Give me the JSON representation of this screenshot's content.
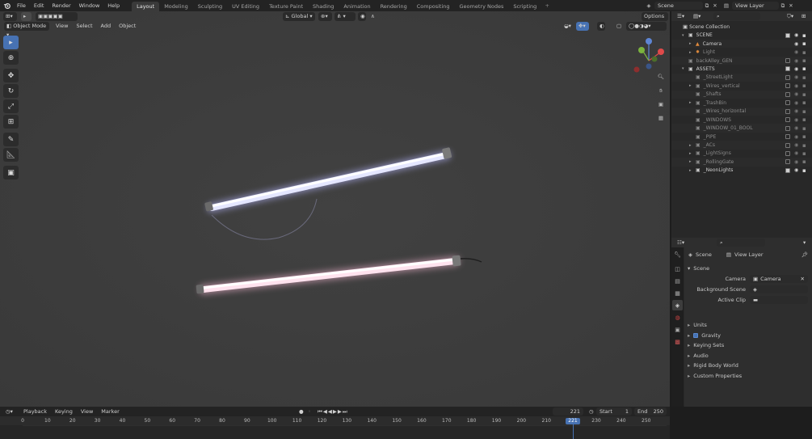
{
  "topbar": {
    "menus": [
      "File",
      "Edit",
      "Render",
      "Window",
      "Help"
    ],
    "workspaces": [
      "Layout",
      "Modeling",
      "Sculpting",
      "UV Editing",
      "Texture Paint",
      "Shading",
      "Animation",
      "Rendering",
      "Compositing",
      "Geometry Nodes",
      "Scripting"
    ],
    "active_workspace": "Layout",
    "scene_name": "Scene",
    "view_layer": "View Layer"
  },
  "viewport_header": {
    "mode": "Object Mode",
    "menus": [
      "View",
      "Select",
      "Add",
      "Object"
    ],
    "transform_orientation": "Global",
    "options_label": "Options"
  },
  "toolbar": {
    "tools": [
      "select-box-tool",
      "cursor-tool",
      "move-tool",
      "rotate-tool",
      "scale-tool",
      "transform-tool",
      "annotate-tool",
      "measure-tool",
      "add-cube-tool"
    ]
  },
  "outliner": {
    "title": "Scene Collection",
    "rows": [
      {
        "label": "SCENE",
        "indent": 1,
        "expand": "open",
        "checked": true,
        "dim": false
      },
      {
        "label": "Camera",
        "indent": 2,
        "expand": "closed",
        "checked": null,
        "dim": false
      },
      {
        "label": "Light",
        "indent": 2,
        "expand": "closed",
        "checked": null,
        "dim": true
      },
      {
        "label": "backAlley_GEN",
        "indent": 1,
        "expand": "none",
        "checked": false,
        "dim": true
      },
      {
        "label": "ASSETS",
        "indent": 1,
        "expand": "open",
        "checked": true,
        "dim": false
      },
      {
        "label": "_StreetLight",
        "indent": 2,
        "expand": "none",
        "checked": false,
        "dim": true
      },
      {
        "label": "_Wires_vertical",
        "indent": 2,
        "expand": "closed",
        "checked": false,
        "dim": true
      },
      {
        "label": "_Shafts",
        "indent": 2,
        "expand": "none",
        "checked": false,
        "dim": true
      },
      {
        "label": "_TrashBin",
        "indent": 2,
        "expand": "closed",
        "checked": false,
        "dim": true
      },
      {
        "label": "_Wires_horizontal",
        "indent": 2,
        "expand": "none",
        "checked": false,
        "dim": true
      },
      {
        "label": "_WINDOWS",
        "indent": 2,
        "expand": "none",
        "checked": false,
        "dim": true
      },
      {
        "label": "_WINDOW_01_BOOL",
        "indent": 2,
        "expand": "none",
        "checked": false,
        "dim": true
      },
      {
        "label": "_PIPE",
        "indent": 2,
        "expand": "none",
        "checked": false,
        "dim": true
      },
      {
        "label": "_ACs",
        "indent": 2,
        "expand": "closed",
        "checked": false,
        "dim": true
      },
      {
        "label": "_LightSigns",
        "indent": 2,
        "expand": "closed",
        "checked": false,
        "dim": true
      },
      {
        "label": "_RollingGate",
        "indent": 2,
        "expand": "closed",
        "checked": false,
        "dim": true
      },
      {
        "label": "_NeonLights",
        "indent": 2,
        "expand": "closed",
        "checked": true,
        "dim": false
      }
    ]
  },
  "properties": {
    "scene_label": "Scene",
    "view_layer_label": "View Layer",
    "section": "Scene",
    "camera_label": "Camera",
    "camera_value": "Camera",
    "background_scene_label": "Background Scene",
    "active_clip_label": "Active Clip",
    "panels": [
      "Units",
      "Gravity",
      "Keying Sets",
      "Audio",
      "Rigid Body World",
      "Custom Properties"
    ],
    "gravity_checked": true
  },
  "timeline": {
    "menus": [
      "Playback",
      "Keying",
      "View",
      "Marker"
    ],
    "current_frame": "221",
    "start_label": "Start",
    "start": "1",
    "end_label": "End",
    "end": "250",
    "ticks": [
      "0",
      "10",
      "20",
      "30",
      "40",
      "50",
      "60",
      "70",
      "80",
      "90",
      "100",
      "110",
      "120",
      "130",
      "140",
      "150",
      "160",
      "170",
      "180",
      "190",
      "200",
      "210",
      "230",
      "240",
      "250"
    ],
    "playhead_label": "221"
  },
  "colors": {
    "accent": "#4772b3",
    "tube_top": "#d9dcff",
    "tube_bottom": "#ffd9ea"
  }
}
